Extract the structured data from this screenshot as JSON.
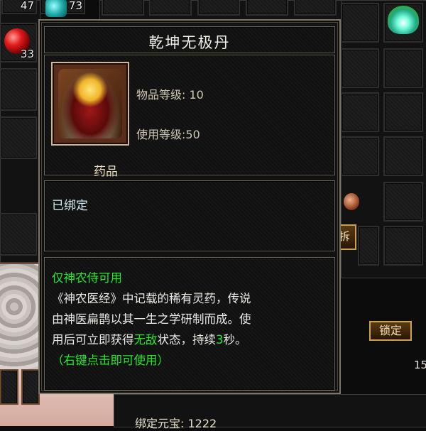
{
  "inventory": {
    "slot_quantities": {
      "top_left": "47",
      "teal_item": "73",
      "red_gem": "33"
    },
    "lock_button_label": "锁定",
    "partial_button_label": "拆",
    "bound_currency_label": "绑定元宝: 1222",
    "right_number": "15"
  },
  "tooltip": {
    "item_name": "乾坤无极丹",
    "item_icon": "golden-elixir-pill-icon",
    "item_level": "物品等级: 10",
    "use_level": "使用等级:50",
    "category": "药品",
    "bind_status": "已绑定",
    "description": {
      "restriction": "仅神农侍可用",
      "line1": "《神农医经》中记载的稀有灵药，传说",
      "line2": "由神医扁鹊以其一生之学研制而成。使",
      "line3_a": "用后可立即获得",
      "line3_highlight": "无敌",
      "line3_b": "状态，持续",
      "line3_num": "3",
      "line3_c": "秒。",
      "hint": "（右键点击即可使用）"
    }
  },
  "colors": {
    "highlight_green": "#24ea2a",
    "bind_text": "#cfeff5",
    "frame_gold": "#7c7563"
  }
}
